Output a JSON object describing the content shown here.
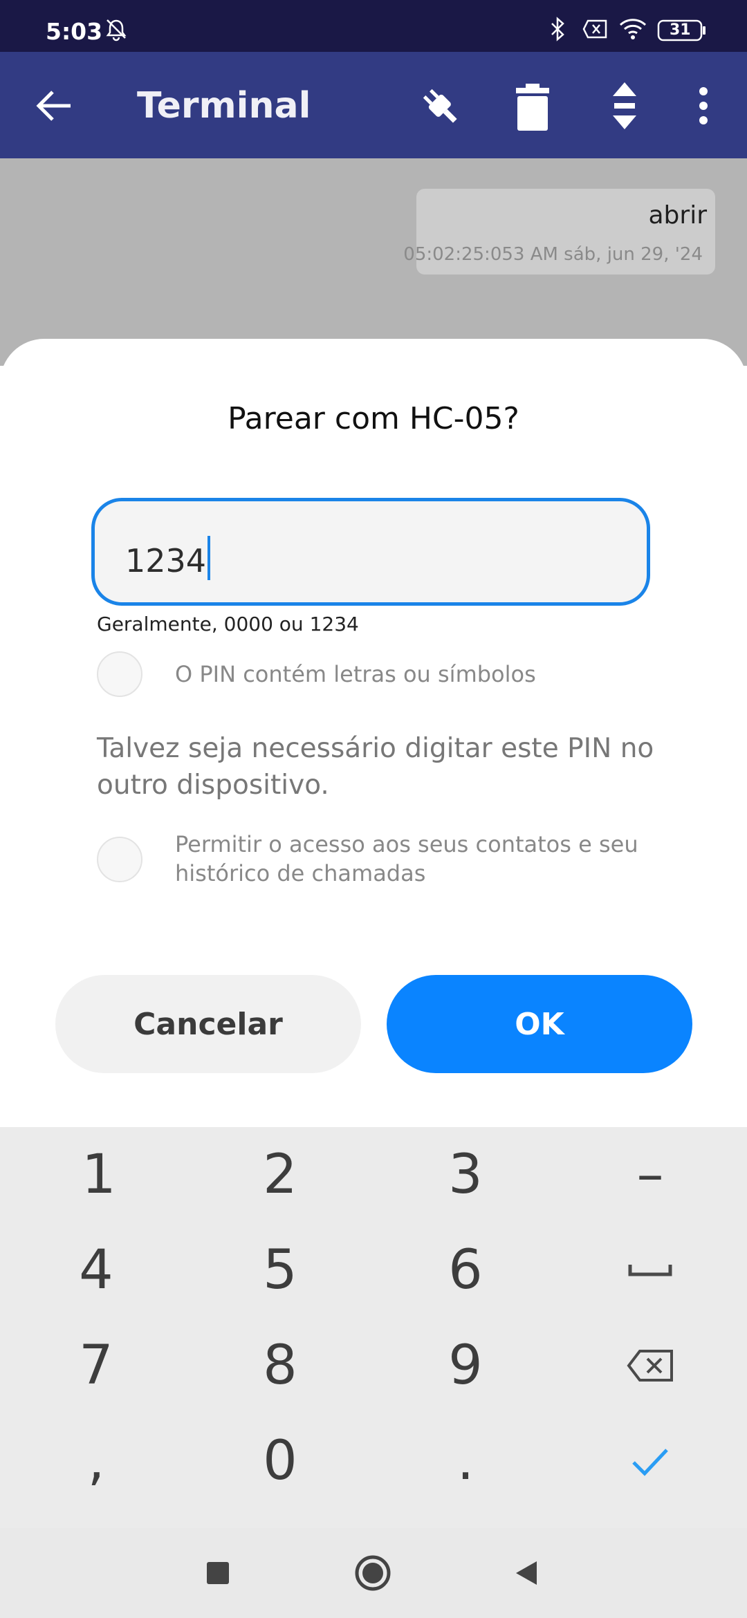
{
  "status_bar": {
    "time": "5:03",
    "battery": "31",
    "icons": [
      "alarm-off-icon",
      "bluetooth-icon",
      "no-sim-icon",
      "wifi-icon",
      "battery-icon"
    ]
  },
  "app_bar": {
    "title": "Terminal",
    "icons": [
      "back-arrow-icon",
      "plug-icon",
      "trash-icon",
      "scroll-icon",
      "more-vert-icon"
    ]
  },
  "terminal": {
    "message": "abrir",
    "timestamp": "05:02:25:053 AM sáb, jun 29, '24"
  },
  "dialog": {
    "title": "Parear com HC-05?",
    "pin_value": "1234",
    "hint": "Geralmente, 0000 ou 1234",
    "option_letters": "O PIN contém letras ou símbolos",
    "info": "Talvez seja necessário digitar este PIN no outro dispositivo.",
    "option_contacts": "Permitir o acesso aos seus contatos e seu histórico de chamadas",
    "cancel_label": "Cancelar",
    "ok_label": "OK"
  },
  "keyboard": {
    "keys": [
      "1",
      "2",
      "3",
      "–",
      "4",
      "5",
      "6",
      "7",
      "8",
      "9",
      ",",
      "0",
      "."
    ],
    "special": [
      "space-icon",
      "backspace-icon",
      "check-icon"
    ],
    "accent": "#2a9df4"
  },
  "nav_bar": {
    "icons": [
      "recents-square-icon",
      "home-circle-icon",
      "back-triangle-icon"
    ]
  },
  "colors": {
    "status_bar": "#1a1846",
    "app_bar": "#323b83",
    "primary": "#0a84ff",
    "input_border": "#1a84e8"
  }
}
